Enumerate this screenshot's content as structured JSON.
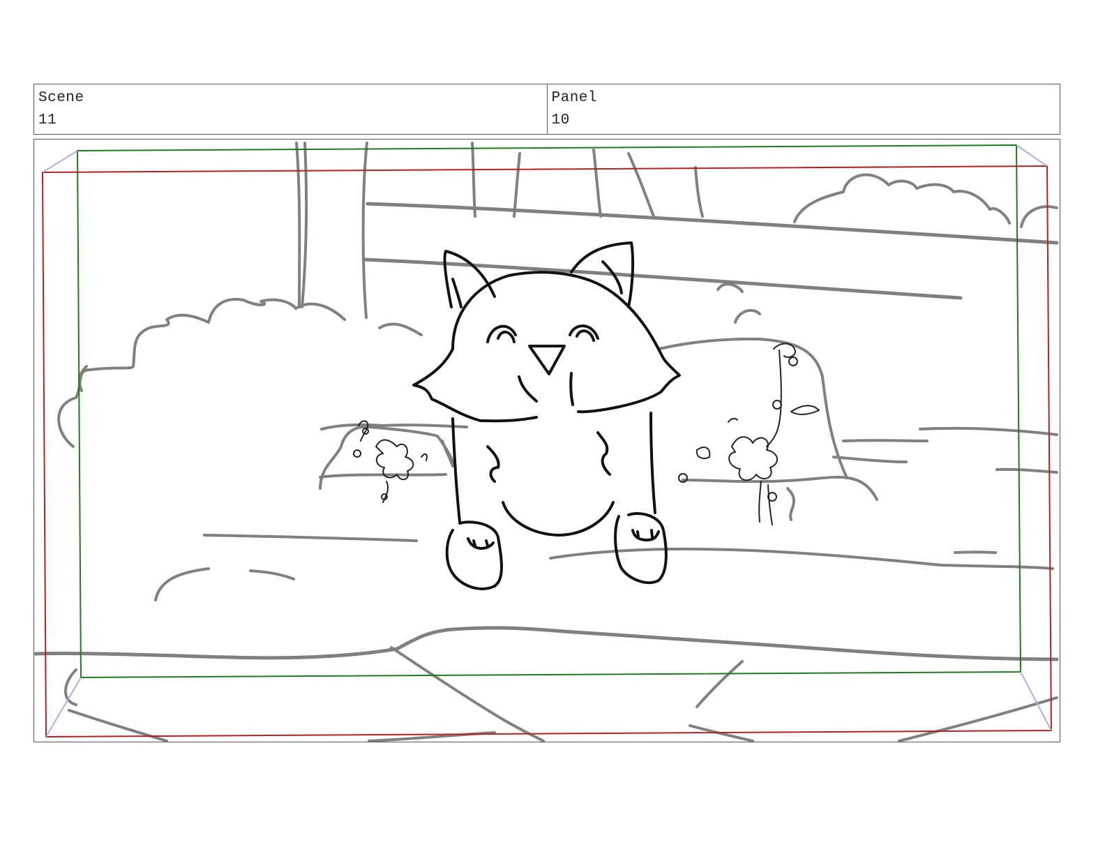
{
  "header": {
    "scene_label": "Scene",
    "scene_value": "11",
    "panel_label": "Panel",
    "panel_value": "10"
  },
  "colors": {
    "safe_frame": "#1f7a1f",
    "camera_frame": "#b22222",
    "background_lines": "#808080",
    "character_lines": "#111111"
  }
}
